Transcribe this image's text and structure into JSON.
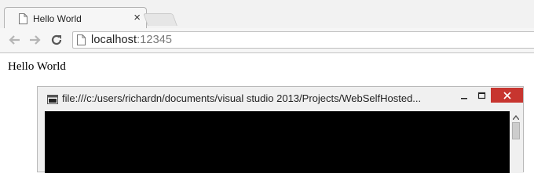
{
  "browser": {
    "tab": {
      "title": "Hello World",
      "close_label": "×"
    },
    "address": {
      "host": "localhost",
      "port": ":12345"
    }
  },
  "page": {
    "text": "Hello World"
  },
  "console_window": {
    "title": "file:///c:/users/richardn/documents/visual studio 2013/Projects/WebSelfHosted...",
    "buttons": {
      "minimize": "–",
      "maximize": "□",
      "close": "×"
    }
  }
}
